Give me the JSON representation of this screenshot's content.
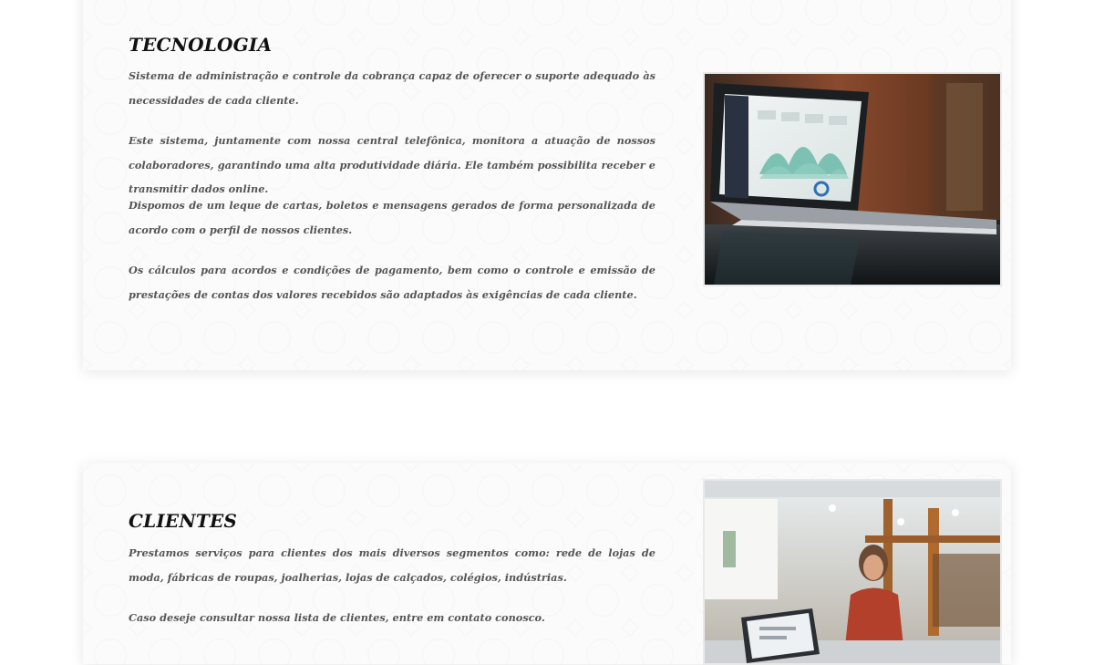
{
  "tecnologia": {
    "heading": "TECNOLOGIA",
    "paragraphs": [
      "Sistema de administração e controle da cobrança capaz de oferecer o suporte adequado às necessidades de cada cliente.",
      "Este sistema, juntamente com nossa central telefônica, monitora a atuação de nossos colaboradores, garantindo uma alta produtividade diária. Ele também possibilita receber e transmitir dados online.",
      "Dispomos de um leque de cartas, boletos e mensagens gerados de forma personalizada de acordo com o perfil de nossos clientes.",
      "Os cálculos para acordos e condições de pagamento, bem como o controle e emissão de prestações de contas dos valores recebidos são adaptados às exigências de cada cliente."
    ],
    "image": "laptop-dashboard-photo"
  },
  "clientes": {
    "heading": "CLIENTES",
    "paragraphs": [
      "Prestamos serviços para clientes dos mais diversos segmentos como: rede de lojas de moda, fábricas de roupas, joalherias, lojas de calçados, colégios, indústrias.",
      "Caso deseje consultar nossa lista de clientes, entre em contato conosco."
    ],
    "image": "store-attendant-photo"
  }
}
